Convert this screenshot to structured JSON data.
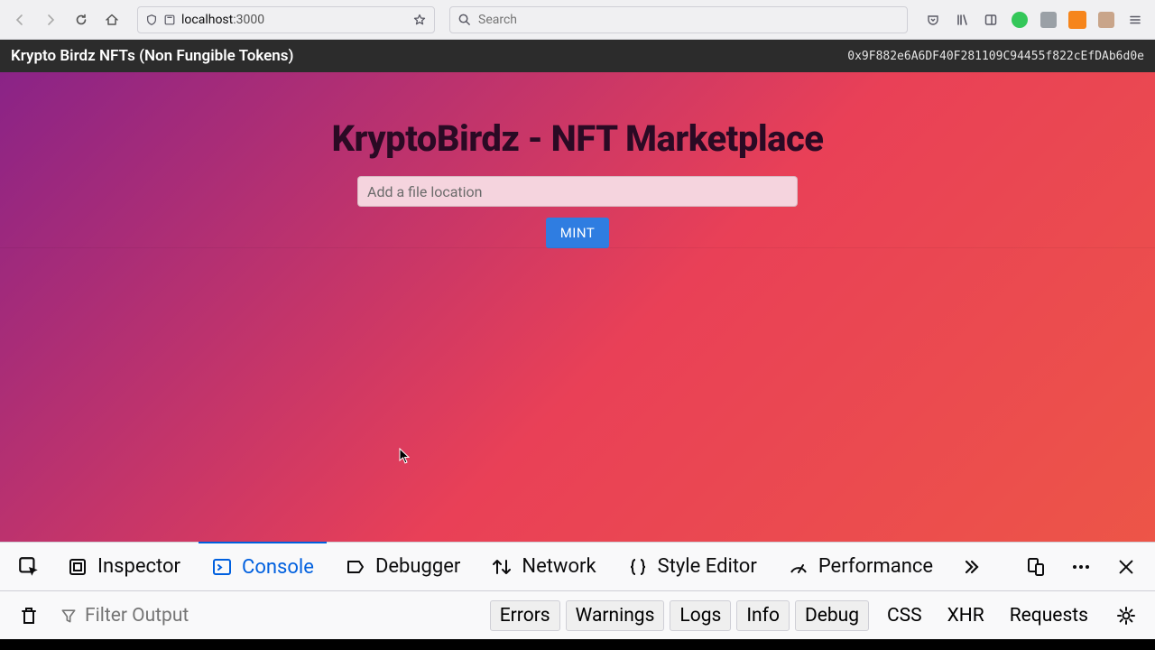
{
  "browser": {
    "url_host": "localhost",
    "url_port": ":3000",
    "search_placeholder": "Search"
  },
  "app": {
    "nav_title": "Krypto Birdz NFTs (Non Fungible Tokens)",
    "wallet_address": "0x9F882e6A6DF40F281109C94455f822cEfDAb6d0e",
    "heading": "KryptoBirdz - NFT Marketplace",
    "input_placeholder": "Add a file location",
    "mint_label": "MINT"
  },
  "devtools": {
    "tabs": {
      "inspector": "Inspector",
      "console": "Console",
      "debugger": "Debugger",
      "network": "Network",
      "style_editor": "Style Editor",
      "performance": "Performance"
    },
    "filter_placeholder": "Filter Output",
    "levels": {
      "errors": "Errors",
      "warnings": "Warnings",
      "logs": "Logs",
      "info": "Info",
      "debug": "Debug"
    },
    "opts": {
      "css": "CSS",
      "xhr": "XHR",
      "requests": "Requests"
    }
  }
}
